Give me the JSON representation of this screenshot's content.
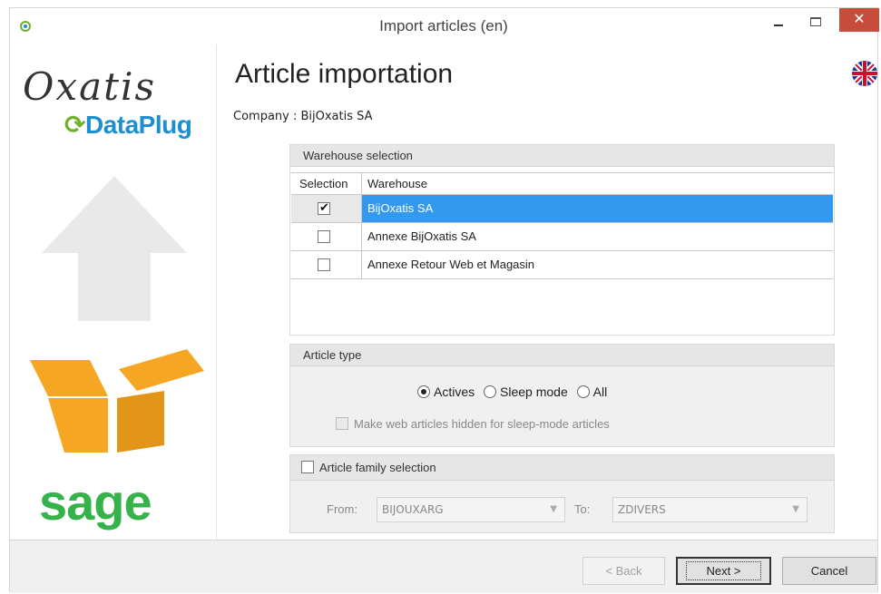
{
  "window": {
    "title": "Import articles (en)",
    "close_glyph": "✕"
  },
  "branding": {
    "oxatis": "Oxatis",
    "dataplug": "DataPlug",
    "sage": "sage"
  },
  "header": {
    "page_title": "Article importation",
    "company": "Company : BijOxatis SA"
  },
  "warehouse": {
    "group_label": "Warehouse selection",
    "columns": [
      "Selection",
      "Warehouse"
    ],
    "rows": [
      {
        "name": "BijOxatis SA",
        "checked": true,
        "selected": true
      },
      {
        "name": "Annexe BijOxatis SA",
        "checked": false,
        "selected": false
      },
      {
        "name": "Annexe Retour Web et Magasin",
        "checked": false,
        "selected": false
      }
    ]
  },
  "article_type": {
    "group_label": "Article type",
    "options": [
      "Actives",
      "Sleep mode",
      "All"
    ],
    "selected": "Actives",
    "hidden_checkbox_label": "Make web articles hidden for sleep-mode articles"
  },
  "family": {
    "checkbox_label": "Article family selection",
    "from_label": "From:",
    "from_value": "BIJOUXARG",
    "to_label": "To:",
    "to_value": "ZDIVERS"
  },
  "buttons": {
    "back": "< Back",
    "next": "Next >",
    "cancel": "Cancel"
  },
  "colors": {
    "selection_blue": "#3399ee",
    "close_red": "#c74c3c",
    "dataplug_blue": "#1d8ed0",
    "sage_green": "#35b24a",
    "box_orange": "#f5a623"
  },
  "icons": [
    "app-icon",
    "minimize-icon",
    "maximize-icon",
    "close-icon",
    "upload-arrow-icon",
    "open-box-icon",
    "uk-flag-icon"
  ]
}
